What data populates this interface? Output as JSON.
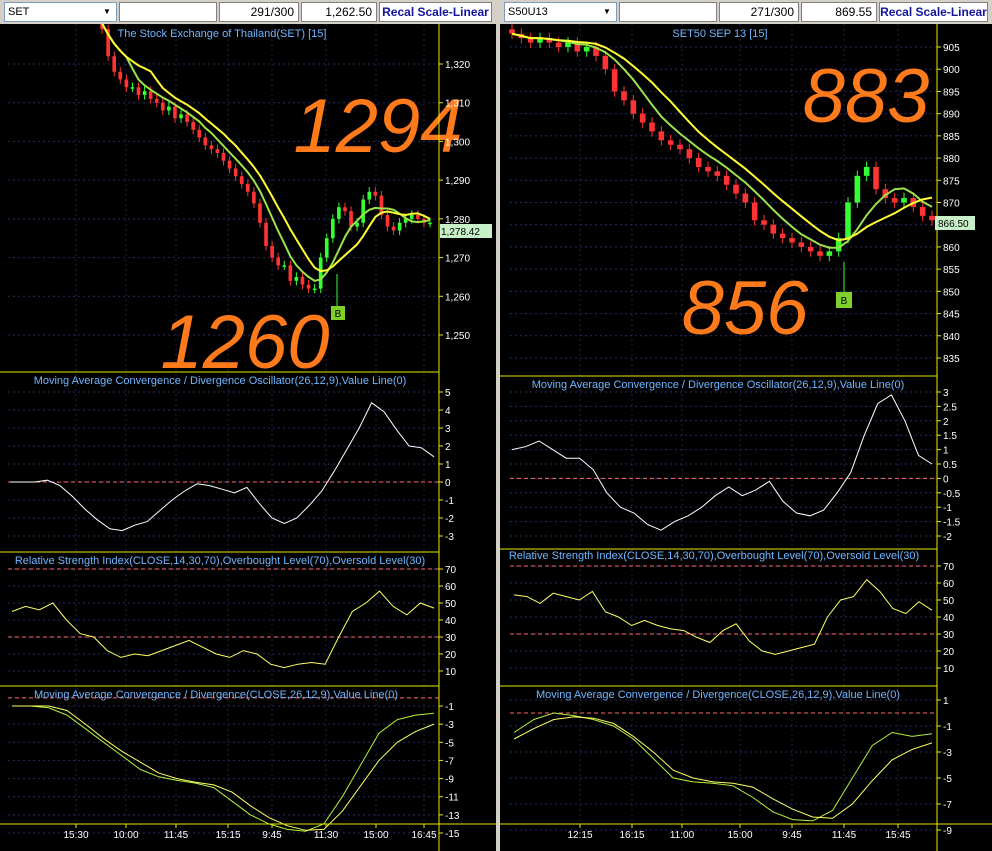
{
  "charts": [
    {
      "id": "left",
      "symbol": "SET",
      "page_counter": "291/300",
      "last_value": "1,262.50",
      "recal_label": "Recal Scale-Linear",
      "price_title": "The Stock Exchange of Thailand(SET) [15]",
      "marker_label": "B",
      "annotation_high": "1294",
      "annotation_low": "1260",
      "last_price_label": "1,278.42",
      "macd_title": "Moving Average Convergence / Divergence Oscillator(26,12,9),Value Line(0)",
      "rsi_title": "Relative Strength Index(CLOSE,14,30,70),Overbought Level(70),Oversold Level(30)",
      "macd2_title": "Moving Average Convergence / Divergence(CLOSE,26,12,9),Value Line(0)",
      "price_ticks": [
        "1,320",
        "1,310",
        "1,300",
        "1,290",
        "1,280",
        "1,270",
        "1,260",
        "1,250"
      ],
      "macd_ticks": [
        "5",
        "4",
        "3",
        "2",
        "1",
        "0",
        "-1",
        "-2",
        "-3"
      ],
      "rsi_ticks": [
        "70",
        "60",
        "50",
        "40",
        "30",
        "20",
        "10"
      ],
      "macd2_ticks": [
        "-1",
        "-3",
        "-5",
        "-7",
        "-9",
        "-11",
        "-13",
        "-15"
      ],
      "time_ticks": [
        "15:30",
        "10:00",
        "11:45",
        "15:15",
        "9:45",
        "11:30",
        "15:00",
        "16:45"
      ]
    },
    {
      "id": "right",
      "symbol": "S50U13",
      "page_counter": "271/300",
      "last_value": "869.55",
      "recal_label": "Recal Scale-Linear",
      "price_title": "SET50 SEP 13  [15]",
      "marker_label": "B",
      "annotation_high": "883",
      "annotation_low": "856",
      "last_price_label": "866.50",
      "macd_title": "Moving Average Convergence / Divergence Oscillator(26,12,9),Value Line(0)",
      "rsi_title": "Relative Strength Index(CLOSE,14,30,70),Overbought Level(70),Oversold Level(30)",
      "macd2_title": "Moving Average Convergence / Divergence(CLOSE,26,12,9),Value Line(0)",
      "price_ticks": [
        "905",
        "900",
        "895",
        "890",
        "885",
        "880",
        "875",
        "870",
        "865",
        "860",
        "855",
        "850",
        "845",
        "840",
        "835"
      ],
      "macd_ticks": [
        "3",
        "2.5",
        "2",
        "1.5",
        "1",
        "0.5",
        "0",
        "-0.5",
        "-1",
        "-1.5",
        "-2"
      ],
      "rsi_ticks": [
        "70",
        "60",
        "50",
        "40",
        "30",
        "20",
        "10"
      ],
      "macd2_ticks": [
        "1",
        "-1",
        "-3",
        "-5",
        "-7",
        "-9"
      ],
      "time_ticks": [
        "12:15",
        "16:15",
        "11:00",
        "15:00",
        "9:45",
        "11:45",
        "15:45"
      ]
    }
  ],
  "chart_data": [
    {
      "type": "candlestick",
      "title": "The Stock Exchange of Thailand(SET) [15]",
      "panel": "price",
      "ylim": [
        1243,
        1334
      ],
      "x": [
        "15:30",
        "10:00",
        "11:45",
        "15:15",
        "9:45",
        "11:30",
        "15:00",
        "16:45"
      ],
      "series": [
        {
          "name": "close",
          "values": [
            1332,
            1329,
            1322,
            1318,
            1316,
            1314,
            1314,
            1312,
            1313,
            1311,
            1310,
            1308,
            1309,
            1306,
            1307,
            1305,
            1303,
            1301,
            1299,
            1298,
            1297,
            1295,
            1293,
            1291,
            1289,
            1287,
            1284,
            1279,
            1273,
            1270,
            1268,
            1268,
            1264,
            1265,
            1263,
            1262,
            1262,
            1270,
            1275,
            1280,
            1283,
            1282,
            1278,
            1279,
            1285,
            1287,
            1286,
            1281,
            1278,
            1277,
            1279,
            1280,
            1281,
            1280,
            1279,
            1279
          ]
        }
      ],
      "annotations": [
        "1294",
        "1260",
        "1,278.42",
        "B"
      ]
    },
    {
      "type": "line",
      "title": "Moving Average Convergence / Divergence Oscillator(26,12,9),Value Line(0)",
      "ylim": [
        -3.6,
        5.3
      ],
      "series": [
        {
          "name": "",
          "values": [
            0,
            0,
            0,
            0.1,
            -0.2,
            -0.8,
            -1.5,
            -2.1,
            -2.6,
            -2.7,
            -2.4,
            -2.2,
            -1.6,
            -1.0,
            -0.5,
            -0.1,
            -0.2,
            -0.4,
            -0.6,
            -0.3,
            -1.2,
            -2.0,
            -2.3,
            -2.0,
            -1.3,
            -0.5,
            0.6,
            1.8,
            3.0,
            4.4,
            3.9,
            2.9,
            2.0,
            1.9,
            1.4
          ]
        }
      ]
    },
    {
      "type": "line",
      "title": "Relative Strength Index(CLOSE,14,30,70),Overbought Level(70),Oversold Level(30)",
      "ylim": [
        0,
        78
      ],
      "series": [
        {
          "name": "",
          "values": [
            45,
            48,
            46,
            50,
            40,
            32,
            30,
            22,
            18,
            20,
            19,
            22,
            25,
            28,
            24,
            20,
            18,
            22,
            20,
            14,
            12,
            14,
            15,
            14,
            30,
            45,
            50,
            57,
            48,
            43,
            50,
            47
          ]
        }
      ]
    },
    {
      "type": "line",
      "title": "Moving Average Convergence / Divergence(CLOSE,26,12,9),Value Line(0)",
      "ylim": [
        -16,
        0.5
      ],
      "series": [
        {
          "name": "",
          "values": [
            -1,
            -1,
            -1.2,
            -2,
            -3.5,
            -5,
            -6.5,
            -8,
            -8.8,
            -9.2,
            -9.5,
            -10,
            -11.5,
            -13,
            -14,
            -14.6,
            -14.8,
            -14,
            -11,
            -7.5,
            -4,
            -2.5,
            -2,
            -1.8
          ]
        },
        {
          "name": "",
          "values": [
            -1,
            -1,
            -1,
            -1.5,
            -3,
            -4.6,
            -6,
            -7.2,
            -8.4,
            -9,
            -9.4,
            -9.7,
            -10.5,
            -12,
            -13.3,
            -14.2,
            -14.7,
            -14.6,
            -12.6,
            -9.8,
            -7,
            -5,
            -3.8,
            -3
          ]
        }
      ]
    },
    {
      "type": "candlestick",
      "title": "SET50 SEP 13  [15]",
      "panel": "price",
      "ylim": [
        831,
        911
      ],
      "x": [
        "12:15",
        "16:15",
        "11:00",
        "15:00",
        "9:45",
        "11:45",
        "15:45"
      ],
      "series": [
        {
          "name": "close",
          "values": [
            908,
            907,
            906,
            907,
            906,
            905,
            906,
            904,
            905,
            903,
            900,
            895,
            893,
            890,
            888,
            886,
            884,
            883,
            882,
            880,
            878,
            877,
            876,
            874,
            872,
            870,
            866,
            865,
            863,
            862,
            861,
            860,
            859,
            858,
            859,
            862,
            870,
            876,
            878,
            873,
            871,
            870,
            871,
            869,
            867,
            866
          ]
        }
      ],
      "annotations": [
        "883",
        "856",
        "866.50",
        "B"
      ]
    },
    {
      "type": "line",
      "title": "Moving Average Convergence / Divergence Oscillator(26,12,9),Value Line(0)",
      "ylim": [
        -2.2,
        3.2
      ],
      "series": [
        {
          "name": "",
          "values": [
            1.0,
            1.1,
            1.3,
            1.0,
            0.7,
            0.7,
            0.3,
            -0.5,
            -1.0,
            -1.2,
            -1.6,
            -1.8,
            -1.5,
            -1.3,
            -1.0,
            -0.6,
            -0.3,
            -0.6,
            -0.4,
            -0.1,
            -0.8,
            -1.2,
            -1.3,
            -1.1,
            -0.5,
            0.2,
            1.5,
            2.6,
            2.9,
            2.0,
            0.8,
            0.5
          ]
        }
      ]
    },
    {
      "type": "line",
      "title": "Relative Strength Index(CLOSE,14,30,70),Overbought Level(70),Oversold Level(30)",
      "ylim": [
        0,
        78
      ],
      "series": [
        {
          "name": "",
          "values": [
            53,
            52,
            48,
            54,
            52,
            50,
            55,
            43,
            40,
            35,
            38,
            35,
            33,
            32,
            28,
            25,
            32,
            36,
            26,
            20,
            18,
            20,
            22,
            24,
            40,
            50,
            52,
            62,
            55,
            45,
            42,
            49,
            44
          ]
        }
      ]
    },
    {
      "type": "line",
      "title": "Moving Average Convergence / Divergence(CLOSE,26,12,9),Value Line(0)",
      "ylim": [
        -9.5,
        1.5
      ],
      "series": [
        {
          "name": "",
          "values": [
            -1.5,
            -0.5,
            0,
            -0.2,
            -0.5,
            -1,
            -2,
            -3.5,
            -5,
            -5.3,
            -5.4,
            -5.6,
            -6.5,
            -7.6,
            -8.2,
            -8.3,
            -7.5,
            -5,
            -2.5,
            -1.5,
            -1.8,
            -1.6
          ]
        },
        {
          "name": "",
          "values": [
            -2,
            -1.2,
            -0.5,
            -0.3,
            -0.4,
            -0.8,
            -1.8,
            -3,
            -4.4,
            -5,
            -5.3,
            -5.4,
            -5.7,
            -6.6,
            -7.4,
            -8.0,
            -8.1,
            -7,
            -5.2,
            -3.6,
            -2.8,
            -2.3
          ]
        }
      ]
    }
  ]
}
